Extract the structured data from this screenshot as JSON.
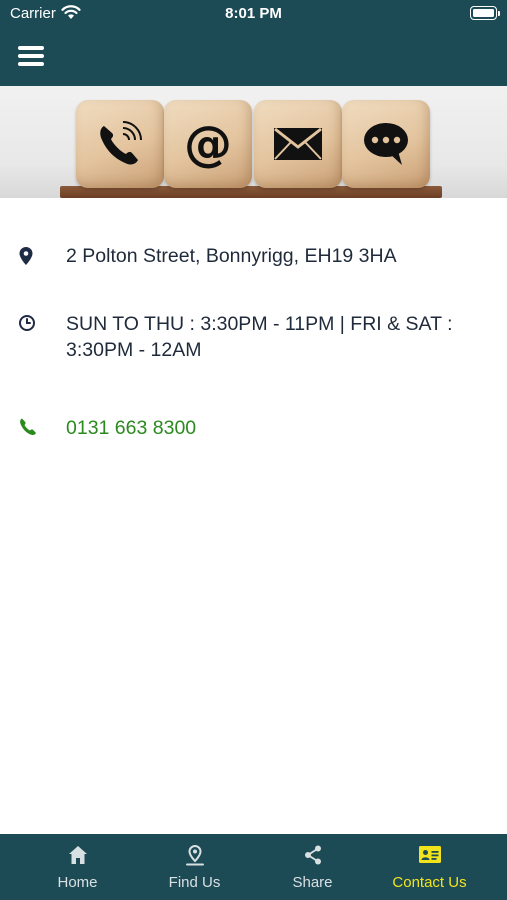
{
  "status_bar": {
    "carrier": "Carrier",
    "time": "8:01 PM"
  },
  "header": {
    "menu_icon": "hamburger-menu-icon"
  },
  "banner": {
    "icons": [
      "phone-icon",
      "at-sign-icon",
      "envelope-icon",
      "chat-bubble-icon"
    ]
  },
  "contact": {
    "address": "2 Polton Street, Bonnyrigg, EH19 3HA",
    "hours": "SUN TO THU : 3:30PM - 11PM | FRI & SAT : 3:30PM - 12AM",
    "phone": "0131 663 8300"
  },
  "tabs": [
    {
      "label": "Home",
      "icon": "home-icon",
      "active": false
    },
    {
      "label": "Find Us",
      "icon": "location-pin-icon",
      "active": false
    },
    {
      "label": "Share",
      "icon": "share-icon",
      "active": false
    },
    {
      "label": "Contact Us",
      "icon": "contact-card-icon",
      "active": true
    }
  ],
  "colors": {
    "brand": "#1c4a55",
    "active_tab": "#f2e41c",
    "phone_link": "#2b8a1e",
    "text": "#1f2a3a"
  }
}
